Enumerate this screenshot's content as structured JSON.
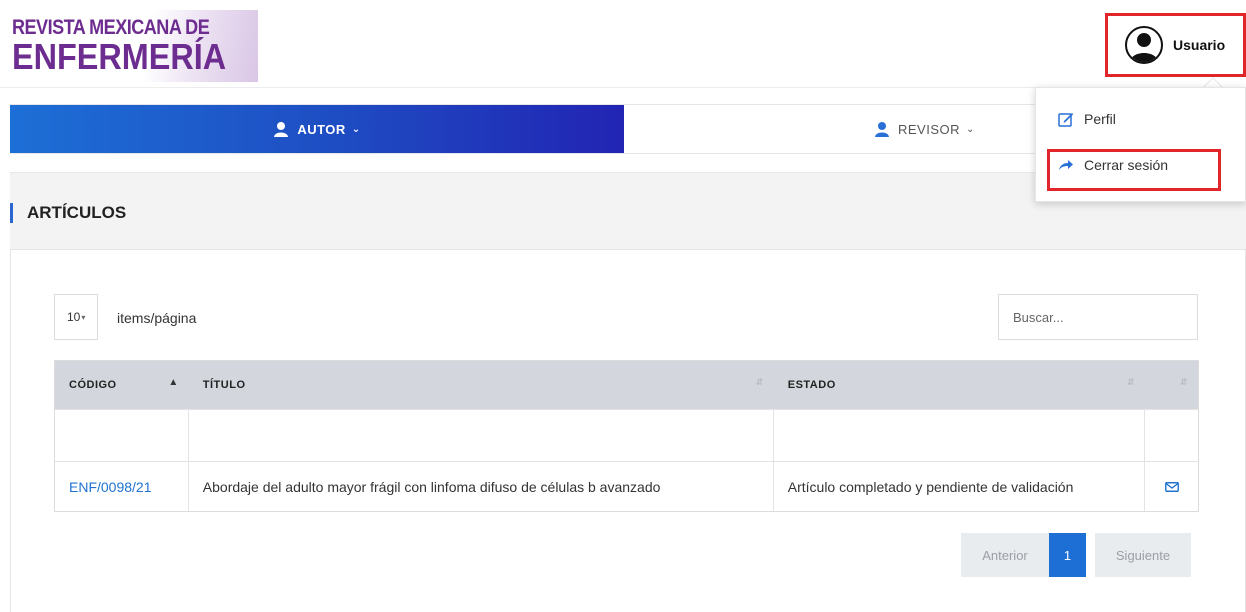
{
  "header": {
    "logo_line1": "REVISTA MEXICANA DE",
    "logo_line2": "ENFERMERÍA",
    "user_label": "Usuario"
  },
  "nav": {
    "autor_label": "AUTOR",
    "revisor_label": "REVISOR",
    "active_color": "#1e4fc4"
  },
  "dropdown": {
    "perfil_label": "Perfil",
    "logout_label": "Cerrar sesión",
    "highlight_color": "#e0262b"
  },
  "page": {
    "title": "ARTÍCULOS"
  },
  "controls": {
    "per_page_value": "10",
    "per_page_label": "items/página",
    "search_placeholder": "Buscar..."
  },
  "table": {
    "headers": [
      "CÓDIGO",
      "TÍTULO",
      "ESTADO",
      ""
    ],
    "rows": [
      {
        "codigo": "ENF/0098/21",
        "titulo": "Abordaje del adulto mayor frágil con linfoma difuso de células b avanzado",
        "estado": "Artículo completado y pendiente de validación",
        "action_icon": "mail-icon"
      }
    ]
  },
  "pagination": {
    "prev_label": "Anterior",
    "current_page": "1",
    "next_label": "Siguiente"
  }
}
